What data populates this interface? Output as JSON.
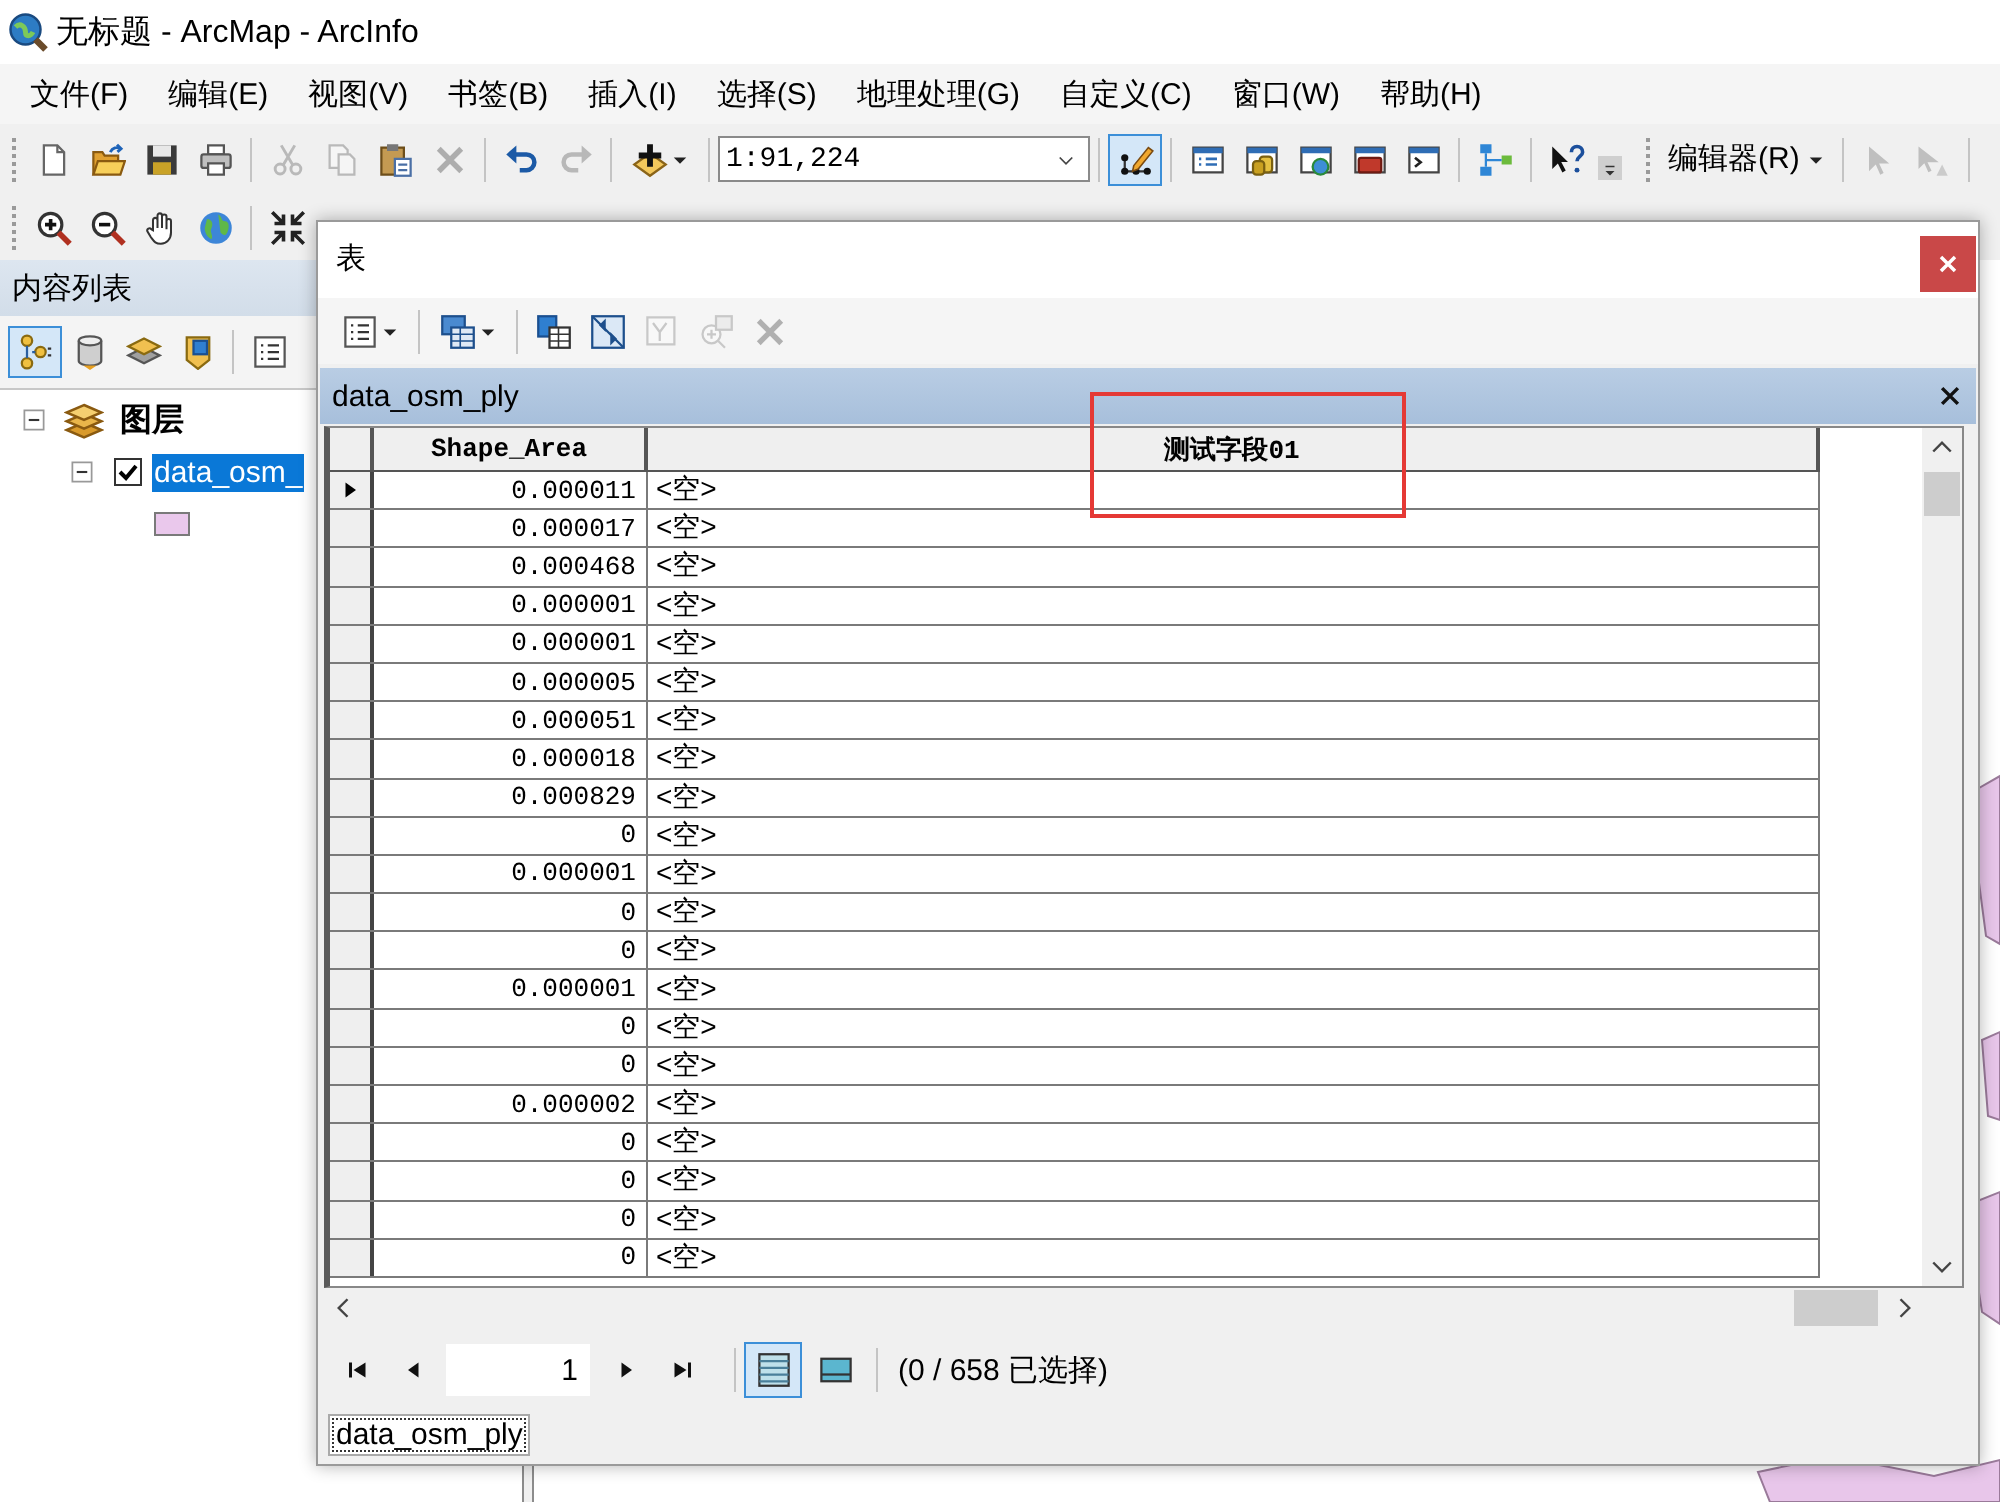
{
  "window": {
    "title": "无标题 - ArcMap - ArcInfo"
  },
  "menu_bar": [
    "文件(F)",
    "编辑(E)",
    "视图(V)",
    "书签(B)",
    "插入(I)",
    "选择(S)",
    "地理处理(G)",
    "自定义(C)",
    "窗口(W)",
    "帮助(H)"
  ],
  "standard_toolbar": [
    {
      "kind": "button",
      "disabled": false,
      "pressed": false
    },
    {
      "kind": "button",
      "disabled": false,
      "pressed": false
    },
    {
      "kind": "button",
      "disabled": false,
      "pressed": false
    },
    {
      "kind": "button",
      "disabled": false,
      "pressed": false
    },
    {
      "kind": "separator"
    },
    {
      "kind": "button",
      "disabled": true,
      "pressed": false
    },
    {
      "kind": "button",
      "disabled": true,
      "pressed": false
    },
    {
      "kind": "button",
      "disabled": false,
      "pressed": false
    },
    {
      "kind": "button",
      "disabled": true,
      "pressed": false
    },
    {
      "kind": "separator"
    },
    {
      "kind": "button",
      "disabled": false,
      "pressed": false
    },
    {
      "kind": "button",
      "disabled": true,
      "pressed": false
    },
    {
      "kind": "separator"
    },
    {
      "kind": "dropdown",
      "disabled": false,
      "pressed": false
    },
    {
      "kind": "separator"
    },
    {
      "kind": "combo",
      "value": "1:91,224"
    },
    {
      "kind": "separator"
    },
    {
      "kind": "button",
      "disabled": false,
      "pressed": true
    },
    {
      "kind": "separator"
    },
    {
      "kind": "button",
      "disabled": false,
      "pressed": false
    },
    {
      "kind": "button",
      "disabled": false,
      "pressed": false
    },
    {
      "kind": "button",
      "disabled": false,
      "pressed": false
    },
    {
      "kind": "button",
      "disabled": false,
      "pressed": false
    },
    {
      "kind": "button",
      "disabled": false,
      "pressed": false
    },
    {
      "kind": "separator"
    },
    {
      "kind": "button",
      "disabled": false,
      "pressed": false
    },
    {
      "kind": "separator"
    },
    {
      "kind": "button",
      "disabled": false,
      "pressed": false
    },
    {
      "kind": "overflow"
    }
  ],
  "editor_toolbar": {
    "menu": "编辑器(R)",
    "tools": [
      {
        "disabled": true
      },
      {
        "disabled": true
      }
    ]
  },
  "contents_panel": {
    "title": "内容列表",
    "views": [
      {
        "selected": true
      },
      {
        "selected": false
      },
      {
        "selected": false
      },
      {
        "selected": false
      }
    ],
    "tree": [
      {
        "kind": "data-frame",
        "label": "图层",
        "expanded": true,
        "children": [
          {
            "kind": "layer",
            "label": "data_osm_",
            "expanded": true,
            "checked": true,
            "selected": true,
            "children": [
              {
                "kind": "symbol",
                "color": "#eac8ec"
              }
            ]
          }
        ]
      }
    ]
  },
  "table_window": {
    "title": "表",
    "toolbar": [
      {
        "kind": "dropdown",
        "disabled": false
      },
      {
        "kind": "separator"
      },
      {
        "kind": "dropdown",
        "disabled": false
      },
      {
        "kind": "separator"
      },
      {
        "kind": "button",
        "disabled": false
      },
      {
        "kind": "button",
        "disabled": false
      },
      {
        "kind": "button",
        "disabled": true
      },
      {
        "kind": "button",
        "disabled": true
      },
      {
        "kind": "button",
        "disabled": true
      }
    ],
    "table_name": "data_osm_ply",
    "columns": [
      {
        "label": "Shape_Area",
        "highlighted": false
      },
      {
        "label": "测试字段01",
        "highlighted": true
      }
    ],
    "rows": [
      {
        "current": true,
        "cells": [
          "0.000011",
          "<空>"
        ]
      },
      {
        "current": false,
        "cells": [
          "0.000017",
          "<空>"
        ]
      },
      {
        "current": false,
        "cells": [
          "0.000468",
          "<空>"
        ]
      },
      {
        "current": false,
        "cells": [
          "0.000001",
          "<空>"
        ]
      },
      {
        "current": false,
        "cells": [
          "0.000001",
          "<空>"
        ]
      },
      {
        "current": false,
        "cells": [
          "0.000005",
          "<空>"
        ]
      },
      {
        "current": false,
        "cells": [
          "0.000051",
          "<空>"
        ]
      },
      {
        "current": false,
        "cells": [
          "0.000018",
          "<空>"
        ]
      },
      {
        "current": false,
        "cells": [
          "0.000829",
          "<空>"
        ]
      },
      {
        "current": false,
        "cells": [
          "0",
          "<空>"
        ]
      },
      {
        "current": false,
        "cells": [
          "0.000001",
          "<空>"
        ]
      },
      {
        "current": false,
        "cells": [
          "0",
          "<空>"
        ]
      },
      {
        "current": false,
        "cells": [
          "0",
          "<空>"
        ]
      },
      {
        "current": false,
        "cells": [
          "0.000001",
          "<空>"
        ]
      },
      {
        "current": false,
        "cells": [
          "0",
          "<空>"
        ]
      },
      {
        "current": false,
        "cells": [
          "0",
          "<空>"
        ]
      },
      {
        "current": false,
        "cells": [
          "0.000002",
          "<空>"
        ]
      },
      {
        "current": false,
        "cells": [
          "0",
          "<空>"
        ]
      },
      {
        "current": false,
        "cells": [
          "0",
          "<空>"
        ]
      },
      {
        "current": false,
        "cells": [
          "0",
          "<空>"
        ]
      },
      {
        "current": false,
        "cells": [
          "0",
          "<空>"
        ]
      }
    ],
    "navigation": {
      "record": "1",
      "views": [
        {
          "selected": true
        },
        {
          "selected": false
        }
      ],
      "status": "(0 / 658 已选择)"
    },
    "tabs": [
      {
        "label": "data_osm_ply",
        "selected": true
      }
    ]
  }
}
